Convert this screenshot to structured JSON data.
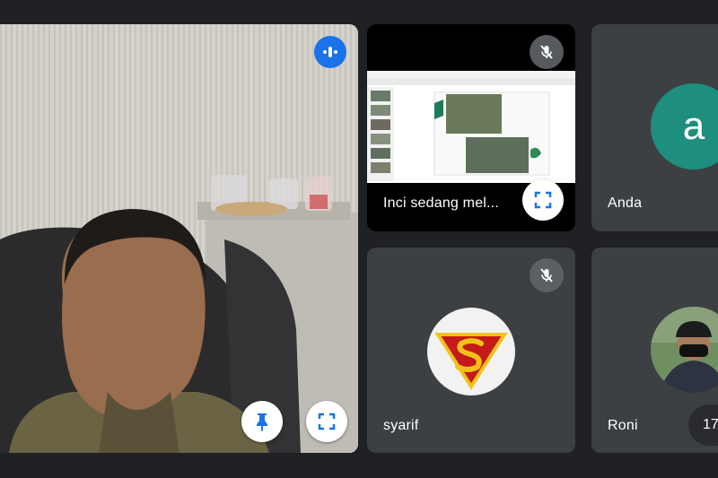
{
  "colors": {
    "background": "#202124",
    "tile": "#3c4043",
    "accent_blue": "#1a73e8",
    "avatar_teal": "#1e8e7e"
  },
  "presenter_tile": {
    "name": "Inci sedang mel..."
  },
  "participants": [
    {
      "name": "Anda",
      "avatar_letter": "a"
    },
    {
      "name": "syarif"
    },
    {
      "name": "Roni"
    }
  ],
  "overflow_badge": "17",
  "icons": {
    "speaking": "speaking-indicator-icon",
    "mic_off": "mic-off-icon",
    "pin": "pin-icon",
    "fullscreen": "fullscreen-icon"
  }
}
